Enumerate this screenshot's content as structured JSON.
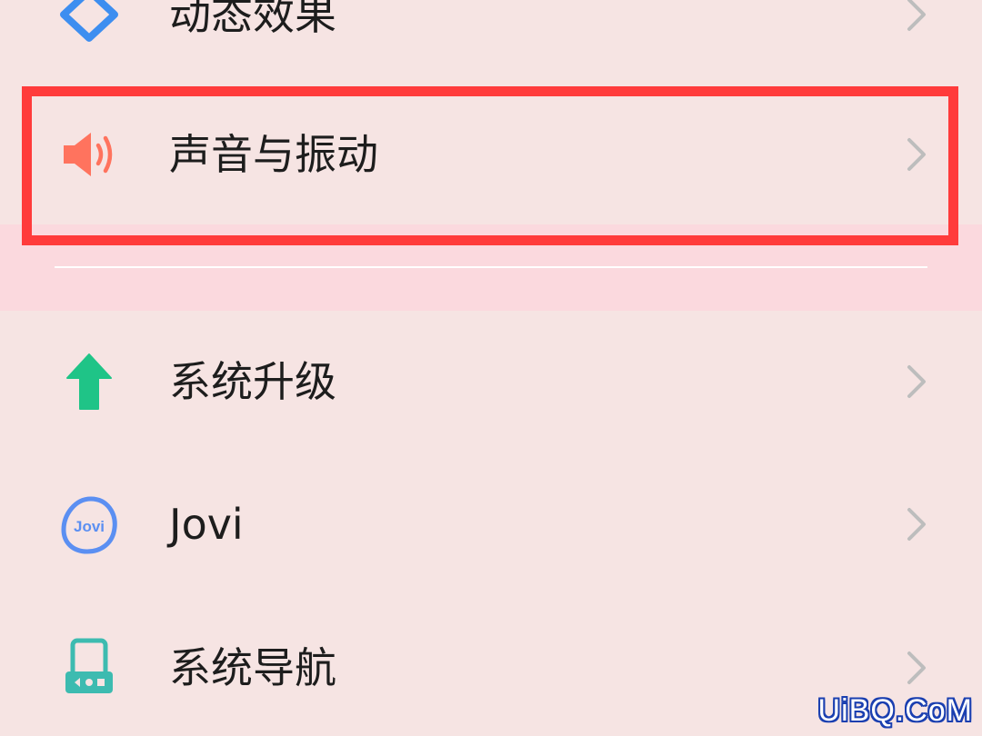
{
  "colors": {
    "background": "#f6e4e3",
    "pressed_band": "#fbd9de",
    "annotation_box": "#ff3b3b",
    "chevron": "#bdbdbd",
    "motion_icon": "#3d8ef0",
    "sound_icon": "#ff735e",
    "upgrade_icon": "#1fc487",
    "jovi_icon": "#5b8ff2",
    "navigation_icon": "#3dbbb0"
  },
  "settings": {
    "items": [
      {
        "label": "动态效果",
        "icon": "motion-effects-icon"
      },
      {
        "label": "声音与振动",
        "icon": "speaker-icon"
      },
      {
        "label": "系统升级",
        "icon": "arrow-up-icon"
      },
      {
        "label": "Jovi",
        "icon": "jovi-icon",
        "icon_text": "Jovi"
      },
      {
        "label": "系统导航",
        "icon": "phone-navigation-icon"
      }
    ]
  },
  "watermark": "UiBQ.CoM"
}
